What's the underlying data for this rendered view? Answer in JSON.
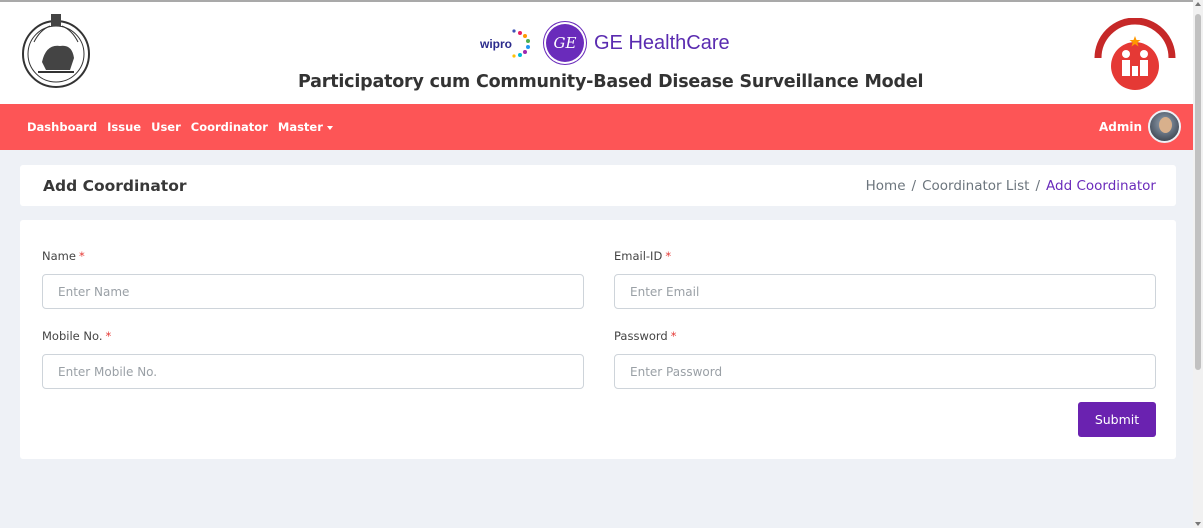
{
  "header": {
    "site_title": "Participatory cum Community-Based Disease Surveillance Model",
    "logos": {
      "left_emblem": "odisha-government-emblem",
      "wipro": "wipro",
      "ge_monogram": "GE",
      "ge_text": "GE HealthCare",
      "right_emblem": "national-health-mission-logo"
    }
  },
  "nav": {
    "items": [
      {
        "label": "Dashboard"
      },
      {
        "label": "Issue"
      },
      {
        "label": "User"
      },
      {
        "label": "Coordinator"
      },
      {
        "label": "Master"
      }
    ],
    "user_label": "Admin"
  },
  "page": {
    "title": "Add Coordinator",
    "breadcrumb": {
      "home": "Home",
      "parent": "Coordinator List",
      "current": "Add Coordinator",
      "separator": "/"
    }
  },
  "form": {
    "name": {
      "label": "Name",
      "required_mark": "*",
      "placeholder": "Enter Name",
      "value": ""
    },
    "email": {
      "label": "Email-ID",
      "required_mark": "*",
      "placeholder": "Enter Email",
      "value": ""
    },
    "mobile": {
      "label": "Mobile No.",
      "required_mark": "*",
      "placeholder": "Enter Mobile No.",
      "value": ""
    },
    "password": {
      "label": "Password",
      "required_mark": "*",
      "placeholder": "Enter Password",
      "value": ""
    },
    "submit_label": "Submit"
  },
  "colors": {
    "navbar": "#fd5556",
    "accent": "#6a22b0",
    "page_bg": "#eef1f6",
    "required": "#e53935"
  }
}
